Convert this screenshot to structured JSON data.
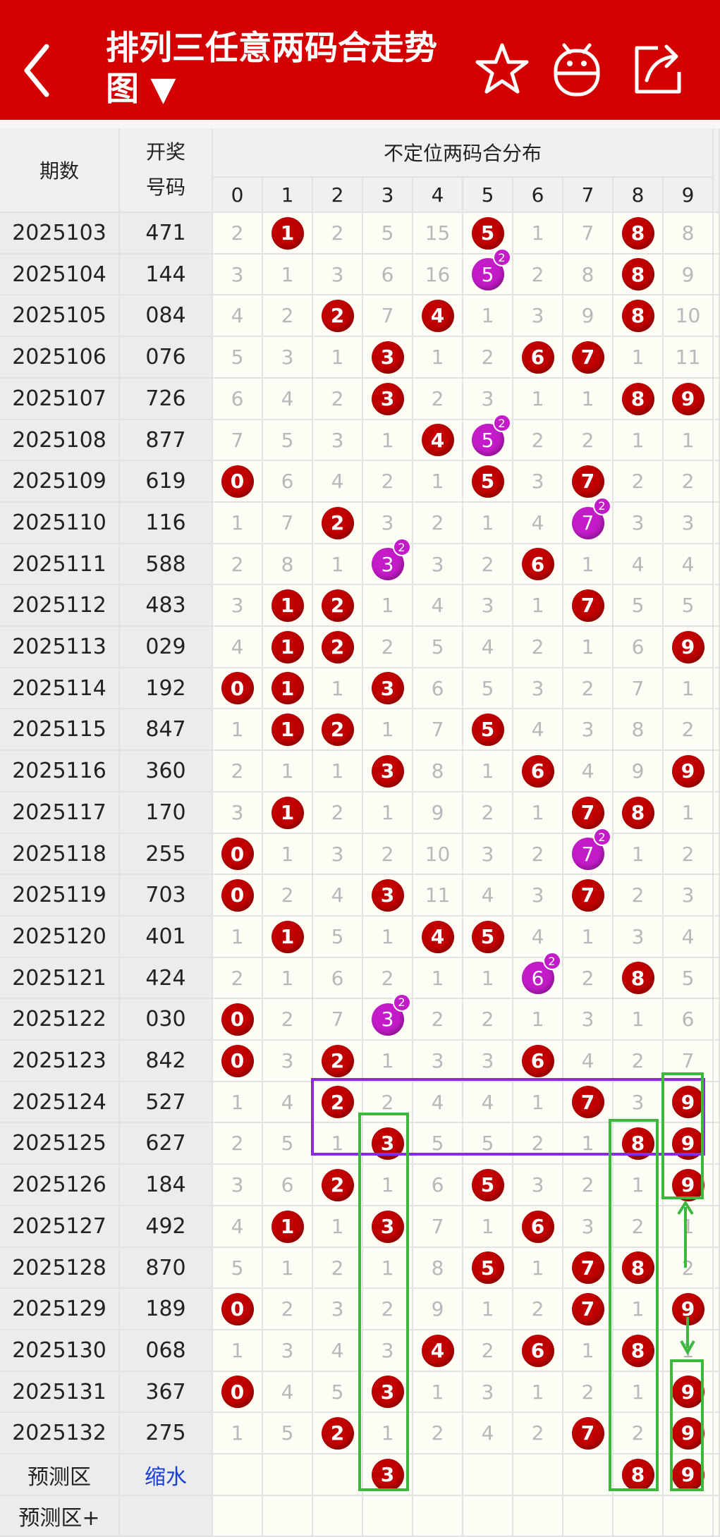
{
  "header": {
    "title_line1": "排列三任意两码合走势",
    "title_line2": "图 ▼",
    "bg_color": "#d40000"
  },
  "table": {
    "col_issue": "期数",
    "col_number": "开奖\n号码",
    "col_group": "不定位两码合分布",
    "digits": [
      "0",
      "1",
      "2",
      "3",
      "4",
      "5",
      "6",
      "7",
      "8",
      "9"
    ],
    "rows": [
      {
        "issue": "2025103",
        "number": "471",
        "cells": [
          "2",
          "@1",
          "2",
          "5",
          "15",
          "@5",
          "1",
          "7",
          "@8",
          "8"
        ]
      },
      {
        "issue": "2025104",
        "number": "144",
        "cells": [
          "3",
          "1",
          "3",
          "6",
          "16",
          "#5",
          "2",
          "8",
          "@8",
          "9"
        ]
      },
      {
        "issue": "2025105",
        "number": "084",
        "cells": [
          "4",
          "2",
          "@2",
          "7",
          "@4",
          "1",
          "3",
          "9",
          "@8",
          "10"
        ]
      },
      {
        "issue": "2025106",
        "number": "076",
        "cells": [
          "5",
          "3",
          "1",
          "@3",
          "1",
          "2",
          "@6",
          "@7",
          "1",
          "11"
        ]
      },
      {
        "issue": "2025107",
        "number": "726",
        "cells": [
          "6",
          "4",
          "2",
          "@3",
          "2",
          "3",
          "1",
          "1",
          "@8",
          "@9"
        ]
      },
      {
        "issue": "2025108",
        "number": "877",
        "cells": [
          "7",
          "5",
          "3",
          "1",
          "@4",
          "#5",
          "2",
          "2",
          "1",
          "1"
        ]
      },
      {
        "issue": "2025109",
        "number": "619",
        "cells": [
          "@0",
          "6",
          "4",
          "2",
          "1",
          "@5",
          "3",
          "@7",
          "2",
          "2"
        ]
      },
      {
        "issue": "2025110",
        "number": "116",
        "cells": [
          "1",
          "7",
          "@2",
          "3",
          "2",
          "1",
          "4",
          "#7",
          "3",
          "3"
        ]
      },
      {
        "issue": "2025111",
        "number": "588",
        "cells": [
          "2",
          "8",
          "1",
          "#3",
          "3",
          "2",
          "@6",
          "1",
          "4",
          "4"
        ]
      },
      {
        "issue": "2025112",
        "number": "483",
        "cells": [
          "3",
          "@1",
          "@2",
          "1",
          "4",
          "3",
          "1",
          "@7",
          "5",
          "5"
        ]
      },
      {
        "issue": "2025113",
        "number": "029",
        "cells": [
          "4",
          "@1",
          "@2",
          "2",
          "5",
          "4",
          "2",
          "1",
          "6",
          "@9"
        ]
      },
      {
        "issue": "2025114",
        "number": "192",
        "cells": [
          "@0",
          "@1",
          "1",
          "@3",
          "6",
          "5",
          "3",
          "2",
          "7",
          "1"
        ]
      },
      {
        "issue": "2025115",
        "number": "847",
        "cells": [
          "1",
          "@1",
          "@2",
          "1",
          "7",
          "@5",
          "4",
          "3",
          "8",
          "2"
        ]
      },
      {
        "issue": "2025116",
        "number": "360",
        "cells": [
          "2",
          "1",
          "1",
          "@3",
          "8",
          "1",
          "@6",
          "4",
          "9",
          "@9"
        ]
      },
      {
        "issue": "2025117",
        "number": "170",
        "cells": [
          "3",
          "@1",
          "2",
          "1",
          "9",
          "2",
          "1",
          "@7",
          "@8",
          "1"
        ]
      },
      {
        "issue": "2025118",
        "number": "255",
        "cells": [
          "@0",
          "1",
          "3",
          "2",
          "10",
          "3",
          "2",
          "#7",
          "1",
          "2"
        ]
      },
      {
        "issue": "2025119",
        "number": "703",
        "cells": [
          "@0",
          "2",
          "4",
          "@3",
          "11",
          "4",
          "3",
          "@7",
          "2",
          "3"
        ]
      },
      {
        "issue": "2025120",
        "number": "401",
        "cells": [
          "1",
          "@1",
          "5",
          "1",
          "@4",
          "@5",
          "4",
          "1",
          "3",
          "4"
        ]
      },
      {
        "issue": "2025121",
        "number": "424",
        "cells": [
          "2",
          "1",
          "6",
          "2",
          "1",
          "1",
          "#6",
          "2",
          "@8",
          "5"
        ]
      },
      {
        "issue": "2025122",
        "number": "030",
        "cells": [
          "@0",
          "2",
          "7",
          "#3",
          "2",
          "2",
          "1",
          "3",
          "1",
          "6"
        ]
      },
      {
        "issue": "2025123",
        "number": "842",
        "cells": [
          "@0",
          "3",
          "@2",
          "1",
          "3",
          "3",
          "@6",
          "4",
          "2",
          "7"
        ]
      },
      {
        "issue": "2025124",
        "number": "527",
        "cells": [
          "1",
          "4",
          "@2",
          "2",
          "4",
          "4",
          "1",
          "@7",
          "3",
          "@9"
        ]
      },
      {
        "issue": "2025125",
        "number": "627",
        "cells": [
          "2",
          "5",
          "1",
          "@3",
          "5",
          "5",
          "2",
          "1",
          "@8",
          "@9"
        ]
      },
      {
        "issue": "2025126",
        "number": "184",
        "cells": [
          "3",
          "6",
          "@2",
          "1",
          "6",
          "@5",
          "3",
          "2",
          "1",
          "@9"
        ]
      },
      {
        "issue": "2025127",
        "number": "492",
        "cells": [
          "4",
          "@1",
          "1",
          "@3",
          "7",
          "1",
          "@6",
          "3",
          "2",
          "1"
        ]
      },
      {
        "issue": "2025128",
        "number": "870",
        "cells": [
          "5",
          "1",
          "2",
          "1",
          "8",
          "@5",
          "1",
          "@7",
          "@8",
          "2"
        ]
      },
      {
        "issue": "2025129",
        "number": "189",
        "cells": [
          "@0",
          "2",
          "3",
          "2",
          "9",
          "1",
          "2",
          "@7",
          "1",
          "@9"
        ]
      },
      {
        "issue": "2025130",
        "number": "068",
        "cells": [
          "1",
          "3",
          "4",
          "3",
          "@4",
          "2",
          "@6",
          "1",
          "@8",
          "1"
        ]
      },
      {
        "issue": "2025131",
        "number": "367",
        "cells": [
          "@0",
          "4",
          "5",
          "@3",
          "1",
          "3",
          "1",
          "2",
          "1",
          "@9"
        ]
      },
      {
        "issue": "2025132",
        "number": "275",
        "cells": [
          "1",
          "5",
          "@2",
          "1",
          "2",
          "4",
          "2",
          "@7",
          "2",
          "@9"
        ]
      }
    ],
    "predict_label": "预测区",
    "predict_value": "缩水",
    "predict_cells": [
      "",
      "",
      "",
      "@3",
      "",
      "",
      "",
      "",
      "@8",
      "@9"
    ],
    "predict_plus_label": "预测区+",
    "repeat_badge": "2"
  },
  "colors": {
    "hit": "#c10000",
    "repeat": "#c31bc8",
    "miss_text": "#b8b8b8",
    "box_green": "#3cb93c",
    "box_purple": "#8a2be2"
  }
}
